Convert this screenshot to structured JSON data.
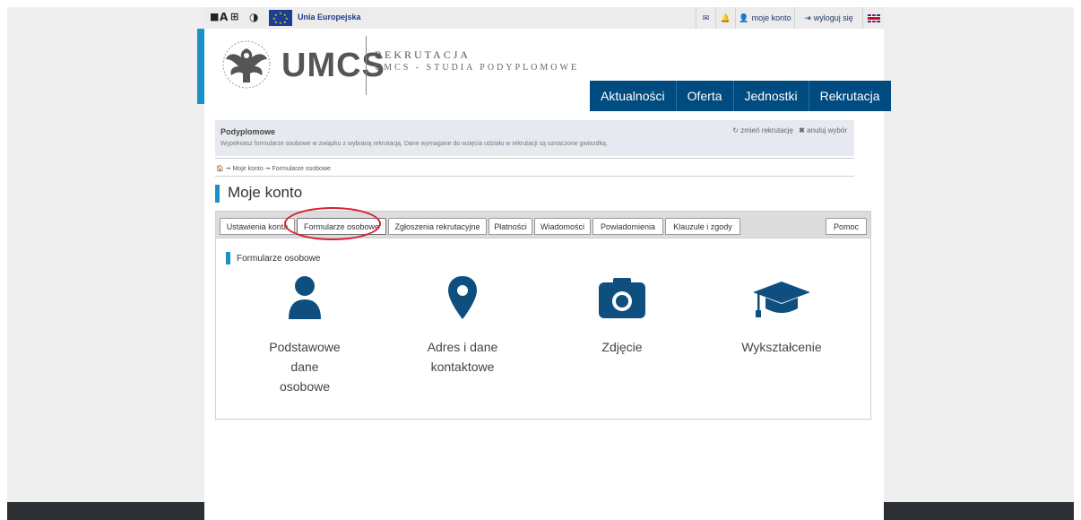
{
  "accessibility": {
    "font_decrease": "A",
    "contrast": "◑"
  },
  "eu": {
    "label": "Unia Europejska"
  },
  "topbar": {
    "account": "moje konto",
    "logout": "wyloguj się"
  },
  "header": {
    "logo_text": "UMCS",
    "subtitle_1": "REKRUTACJA",
    "subtitle_2": "UMCS - STUDIA PODYPLOMOWE"
  },
  "nav": {
    "items": [
      "Aktualności",
      "Oferta",
      "Jednostki",
      "Rekrutacja"
    ]
  },
  "info": {
    "title": "Podyplomowe",
    "description": "Wypełniasz formularze osobowe w związku z wybraną rekrutacją. Dane wymagane do wzięcia udziału w rekrutacji są oznaczone gwiazdką.",
    "change_link": "zmień rekrutację",
    "cancel_link": "anuluj wybór"
  },
  "breadcrumb": {
    "item_1": "Moje konto",
    "item_2": "Formularze osobowe",
    "sep": "➞"
  },
  "page": {
    "title": "Moje konto"
  },
  "tabs": {
    "items": [
      "Ustawienia konta",
      "Formularze osobowe",
      "Zgłoszenia rekrutacyjne",
      "Płatności",
      "Wiadomości",
      "Powiadomienia",
      "Klauzule i zgody"
    ],
    "active": "Formularze osobowe",
    "help": "Pomoc"
  },
  "section": {
    "title": "Formularze osobowe"
  },
  "cards": [
    {
      "label": "Podstawowe\ndane\nosobowe",
      "icon": "user-icon"
    },
    {
      "label": "Adres i dane\nkontaktowe",
      "icon": "map-marker-icon"
    },
    {
      "label": "Zdjęcie",
      "icon": "camera-icon"
    },
    {
      "label": "Wykształcenie",
      "icon": "graduation-cap-icon"
    }
  ],
  "colors": {
    "nav": "#004b7f",
    "accent": "#1a92c7",
    "icon": "#0e4f7f",
    "highlight": "#d4212f"
  }
}
